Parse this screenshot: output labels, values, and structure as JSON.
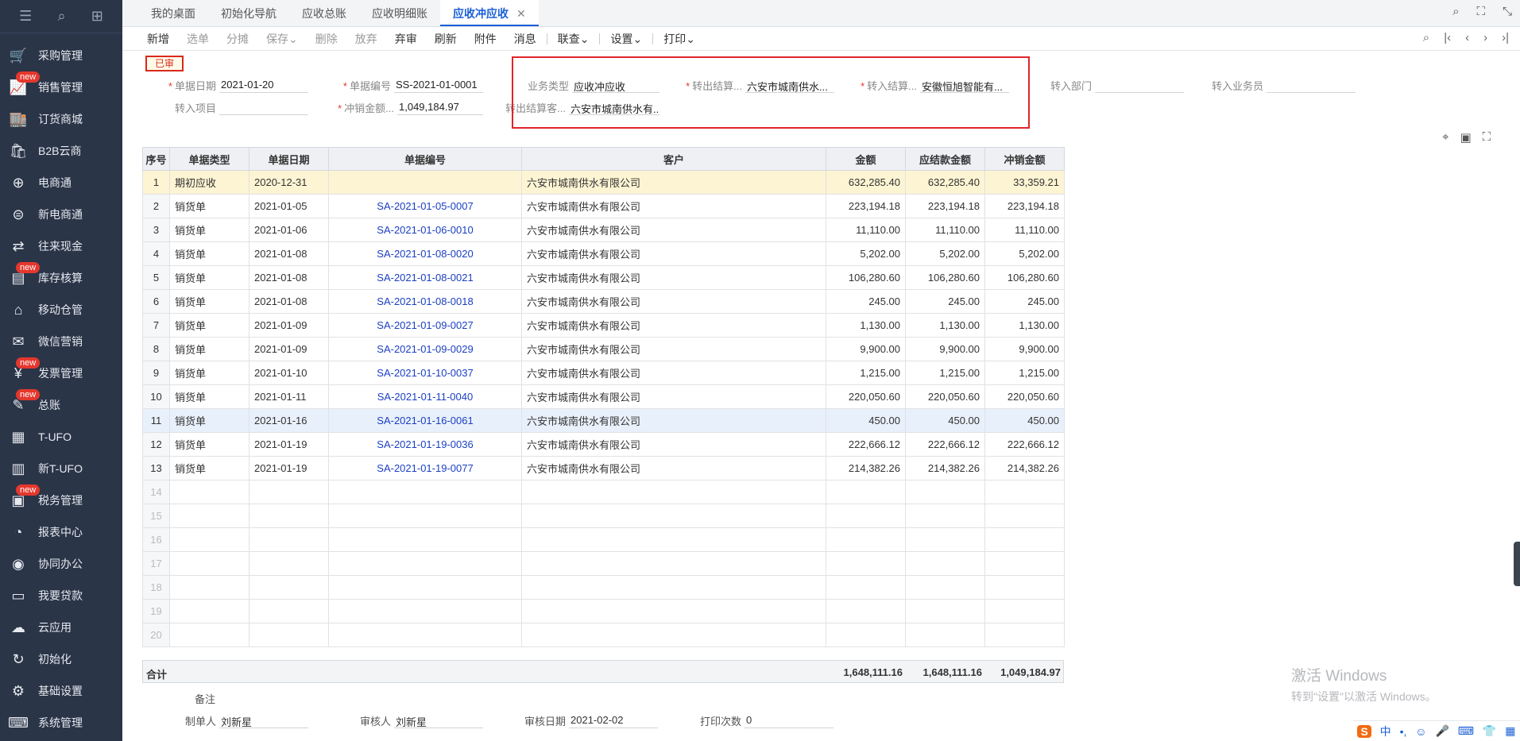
{
  "sidebar": {
    "top_icons": [
      "menu-icon",
      "search-doc-icon",
      "add-doc-icon"
    ],
    "items": [
      {
        "label": "采购管理",
        "icon": "cart-icon",
        "glyph": "🛒",
        "badge": ""
      },
      {
        "label": "销售管理",
        "icon": "sales-chart-icon",
        "glyph": "📈",
        "badge": "new"
      },
      {
        "label": "订货商城",
        "icon": "store-icon",
        "glyph": "🏬",
        "badge": ""
      },
      {
        "label": "B2B云商",
        "icon": "cloud-bag-icon",
        "glyph": "🛍",
        "badge": ""
      },
      {
        "label": "电商通",
        "icon": "ecommerce-icon",
        "glyph": "⊕",
        "badge": ""
      },
      {
        "label": "新电商通",
        "icon": "new-ecommerce-icon",
        "glyph": "⊜",
        "badge": ""
      },
      {
        "label": "往来现金",
        "icon": "exchange-icon",
        "glyph": "⇄",
        "badge": ""
      },
      {
        "label": "库存核算",
        "icon": "inventory-icon",
        "glyph": "▤",
        "badge": "new"
      },
      {
        "label": "移动仓管",
        "icon": "mobile-warehouse-icon",
        "glyph": "⌂",
        "badge": ""
      },
      {
        "label": "微信营销",
        "icon": "wechat-icon",
        "glyph": "✉",
        "badge": ""
      },
      {
        "label": "发票管理",
        "icon": "invoice-icon",
        "glyph": "¥",
        "badge": "new"
      },
      {
        "label": "总账",
        "icon": "ledger-icon",
        "glyph": "✎",
        "badge": "new"
      },
      {
        "label": "T-UFO",
        "icon": "ufo-icon",
        "glyph": "▦",
        "badge": ""
      },
      {
        "label": "新T-UFO",
        "icon": "new-ufo-icon",
        "glyph": "▥",
        "badge": ""
      },
      {
        "label": "税务管理",
        "icon": "tax-icon",
        "glyph": "▣",
        "badge": "new"
      },
      {
        "label": "报表中心",
        "icon": "report-icon",
        "glyph": "◔",
        "badge": ""
      },
      {
        "label": "协同办公",
        "icon": "collab-icon",
        "glyph": "◉",
        "badge": ""
      },
      {
        "label": "我要贷款",
        "icon": "loan-icon",
        "glyph": "▭",
        "badge": ""
      },
      {
        "label": "云应用",
        "icon": "cloud-icon",
        "glyph": "☁",
        "badge": ""
      },
      {
        "label": "初始化",
        "icon": "init-icon",
        "glyph": "↻",
        "badge": ""
      },
      {
        "label": "基础设置",
        "icon": "settings-icon",
        "glyph": "⚙",
        "badge": ""
      },
      {
        "label": "系统管理",
        "icon": "system-icon",
        "glyph": "⌨",
        "badge": ""
      }
    ]
  },
  "tabs": [
    {
      "label": "我的桌面",
      "active": false
    },
    {
      "label": "初始化导航",
      "active": false
    },
    {
      "label": "应收总账",
      "active": false
    },
    {
      "label": "应收明细账",
      "active": false
    },
    {
      "label": "应收冲应收",
      "active": true
    }
  ],
  "tab_close": "✕",
  "toolbar": {
    "buttons": [
      {
        "label": "新增",
        "disabled": false
      },
      {
        "label": "选单",
        "disabled": true
      },
      {
        "label": "分摊",
        "disabled": true
      },
      {
        "label": "保存",
        "disabled": true,
        "dropdown": true
      },
      {
        "label": "删除",
        "disabled": true
      },
      {
        "label": "放弃",
        "disabled": true
      },
      {
        "label": "弃审",
        "disabled": false
      },
      {
        "label": "刷新",
        "disabled": false
      },
      {
        "label": "附件",
        "disabled": false
      },
      {
        "label": "消息",
        "disabled": false
      },
      {
        "label": "联查",
        "disabled": false,
        "dropdown": true
      },
      {
        "label": "设置",
        "disabled": false,
        "dropdown": true
      },
      {
        "label": "打印",
        "disabled": false,
        "dropdown": true
      }
    ],
    "dropdown_glyph": "⌄"
  },
  "status": "已审",
  "form": {
    "doc_date": {
      "label": "单据日期",
      "value": "2021-01-20"
    },
    "doc_no": {
      "label": "单据编号",
      "value": "SS-2021-01-0001"
    },
    "biz_type": {
      "label": "业务类型",
      "value": "应收冲应收"
    },
    "out_settle": {
      "label": "转出结算...",
      "value": "六安市城南供水..."
    },
    "in_settle": {
      "label": "转入结算...",
      "value": "安徽恒旭智能有..."
    },
    "in_dept": {
      "label": "转入部门",
      "value": ""
    },
    "in_staff": {
      "label": "转入业务员",
      "value": ""
    },
    "in_project": {
      "label": "转入项目",
      "value": ""
    },
    "writeoff_amount": {
      "label": "冲销金额...",
      "value": "1,049,184.97"
    },
    "out_customer": {
      "label": "转出结算客...",
      "value": "六安市城南供水有..."
    }
  },
  "grid": {
    "headers": [
      "序号",
      "单据类型",
      "单据日期",
      "单据编号",
      "客户",
      "金额",
      "应结款金额",
      "冲销金额"
    ],
    "rows": [
      {
        "no": "1",
        "type": "期初应收",
        "date": "2020-12-31",
        "code": "",
        "customer": "六安市城南供水有限公司",
        "amount": "632,285.40",
        "due": "632,285.40",
        "writeoff": "33,359.21"
      },
      {
        "no": "2",
        "type": "销货单",
        "date": "2021-01-05",
        "code": "SA-2021-01-05-0007",
        "customer": "六安市城南供水有限公司",
        "amount": "223,194.18",
        "due": "223,194.18",
        "writeoff": "223,194.18"
      },
      {
        "no": "3",
        "type": "销货单",
        "date": "2021-01-06",
        "code": "SA-2021-01-06-0010",
        "customer": "六安市城南供水有限公司",
        "amount": "11,110.00",
        "due": "11,110.00",
        "writeoff": "11,110.00"
      },
      {
        "no": "4",
        "type": "销货单",
        "date": "2021-01-08",
        "code": "SA-2021-01-08-0020",
        "customer": "六安市城南供水有限公司",
        "amount": "5,202.00",
        "due": "5,202.00",
        "writeoff": "5,202.00"
      },
      {
        "no": "5",
        "type": "销货单",
        "date": "2021-01-08",
        "code": "SA-2021-01-08-0021",
        "customer": "六安市城南供水有限公司",
        "amount": "106,280.60",
        "due": "106,280.60",
        "writeoff": "106,280.60"
      },
      {
        "no": "6",
        "type": "销货单",
        "date": "2021-01-08",
        "code": "SA-2021-01-08-0018",
        "customer": "六安市城南供水有限公司",
        "amount": "245.00",
        "due": "245.00",
        "writeoff": "245.00"
      },
      {
        "no": "7",
        "type": "销货单",
        "date": "2021-01-09",
        "code": "SA-2021-01-09-0027",
        "customer": "六安市城南供水有限公司",
        "amount": "1,130.00",
        "due": "1,130.00",
        "writeoff": "1,130.00"
      },
      {
        "no": "8",
        "type": "销货单",
        "date": "2021-01-09",
        "code": "SA-2021-01-09-0029",
        "customer": "六安市城南供水有限公司",
        "amount": "9,900.00",
        "due": "9,900.00",
        "writeoff": "9,900.00"
      },
      {
        "no": "9",
        "type": "销货单",
        "date": "2021-01-10",
        "code": "SA-2021-01-10-0037",
        "customer": "六安市城南供水有限公司",
        "amount": "1,215.00",
        "due": "1,215.00",
        "writeoff": "1,215.00"
      },
      {
        "no": "10",
        "type": "销货单",
        "date": "2021-01-11",
        "code": "SA-2021-01-11-0040",
        "customer": "六安市城南供水有限公司",
        "amount": "220,050.60",
        "due": "220,050.60",
        "writeoff": "220,050.60"
      },
      {
        "no": "11",
        "type": "销货单",
        "date": "2021-01-16",
        "code": "SA-2021-01-16-0061",
        "customer": "六安市城南供水有限公司",
        "amount": "450.00",
        "due": "450.00",
        "writeoff": "450.00"
      },
      {
        "no": "12",
        "type": "销货单",
        "date": "2021-01-19",
        "code": "SA-2021-01-19-0036",
        "customer": "六安市城南供水有限公司",
        "amount": "222,666.12",
        "due": "222,666.12",
        "writeoff": "222,666.12"
      },
      {
        "no": "13",
        "type": "销货单",
        "date": "2021-01-19",
        "code": "SA-2021-01-19-0077",
        "customer": "六安市城南供水有限公司",
        "amount": "214,382.26",
        "due": "214,382.26",
        "writeoff": "214,382.26"
      }
    ],
    "empty_rows": [
      "14",
      "15",
      "16",
      "17",
      "18",
      "19",
      "20"
    ],
    "selected_row": 0,
    "hover_row": 10
  },
  "totals": {
    "label": "合计",
    "amount": "1,648,111.16",
    "due": "1,648,111.16",
    "writeoff": "1,049,184.97"
  },
  "footer": {
    "remark": {
      "label": "备注",
      "value": ""
    },
    "maker": {
      "label": "制单人",
      "value": "刘新星"
    },
    "auditor": {
      "label": "审核人",
      "value": "刘新星"
    },
    "audit_date": {
      "label": "审核日期",
      "value": "2021-02-02"
    },
    "print_count": {
      "label": "打印次数",
      "value": "0"
    }
  },
  "watermark": {
    "line1": "激活 Windows",
    "line2": "转到\"设置\"以激活 Windows。"
  },
  "ime": {
    "logo": "S",
    "items": [
      "中",
      "•,",
      "☺",
      "🎤",
      "⌨",
      "👕",
      "▦"
    ]
  },
  "colors": {
    "sidebar_bg": "#2b3548",
    "accent": "#1a5fd6",
    "badge": "#e5372d",
    "highlight": "#e0242a"
  }
}
